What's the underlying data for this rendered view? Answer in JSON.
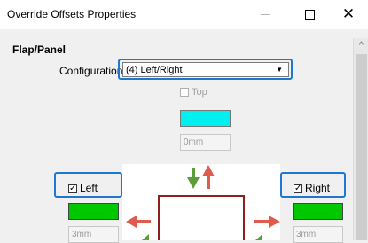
{
  "window": {
    "title": "Override Offsets Properties",
    "minimize_icon": "minimize-icon",
    "maximize_icon": "maximize-icon",
    "close_glyph": "✕"
  },
  "scrollbar": {
    "up_glyph": "^"
  },
  "section": {
    "title": "Flap/Panel"
  },
  "configuration": {
    "label": "Configuration",
    "value": "(4) Left/Right",
    "arrow": "▼"
  },
  "top": {
    "label": "Top",
    "checked": false,
    "enabled": false,
    "color": "#00f0f0",
    "value": "0mm"
  },
  "left": {
    "label": "Left",
    "checked": true,
    "color": "#00c800",
    "value": "3mm"
  },
  "right": {
    "label": "Right",
    "checked": true,
    "color": "#00c800",
    "value": "3mm"
  },
  "colors": {
    "highlight": "#1e78d2",
    "arrow_red": "#e05a4e",
    "arrow_green": "#5a9e3a",
    "panel_border": "#8c2020"
  }
}
